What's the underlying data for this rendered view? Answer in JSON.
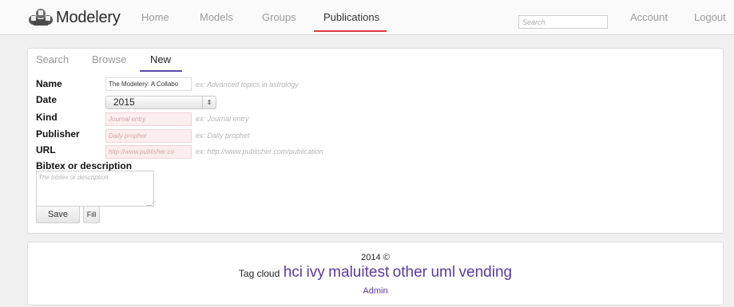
{
  "brand": {
    "name": "Modelery"
  },
  "nav": {
    "items": [
      {
        "label": "Home"
      },
      {
        "label": "Models"
      },
      {
        "label": "Groups"
      },
      {
        "label": "Publications"
      }
    ],
    "search_placeholder": "Search",
    "account": "Account",
    "logout": "Logout"
  },
  "subtabs": [
    {
      "label": "Search"
    },
    {
      "label": "Browse"
    },
    {
      "label": "New"
    }
  ],
  "form": {
    "name": {
      "label": "Name",
      "value": "The Modelery: A Collabo",
      "hint": "ex: Advanced topics in astrology"
    },
    "date": {
      "label": "Date",
      "value": "2015",
      "arrow": "⇕"
    },
    "kind": {
      "label": "Kind",
      "placeholder": "Journal entry",
      "hint": "ex: Journal entry"
    },
    "publisher": {
      "label": "Publisher",
      "placeholder": "Daily prophet",
      "hint": "ex: Daily prophet"
    },
    "url": {
      "label": "URL",
      "placeholder": "http://www.publisher.co",
      "hint": "ex: http://www.publisher.com/publication"
    },
    "bibtex": {
      "label": "Bibtex or description",
      "placeholder": "The bibtex or description"
    },
    "save_label": "Save",
    "fill_label": "Fill"
  },
  "footer": {
    "copyright": "2014 ©",
    "tagcloud_label": "Tag cloud",
    "tags": [
      "hci",
      "ivy",
      "mal",
      "ui",
      "test",
      "other",
      "uml",
      "vending"
    ],
    "admin": "Admin"
  }
}
